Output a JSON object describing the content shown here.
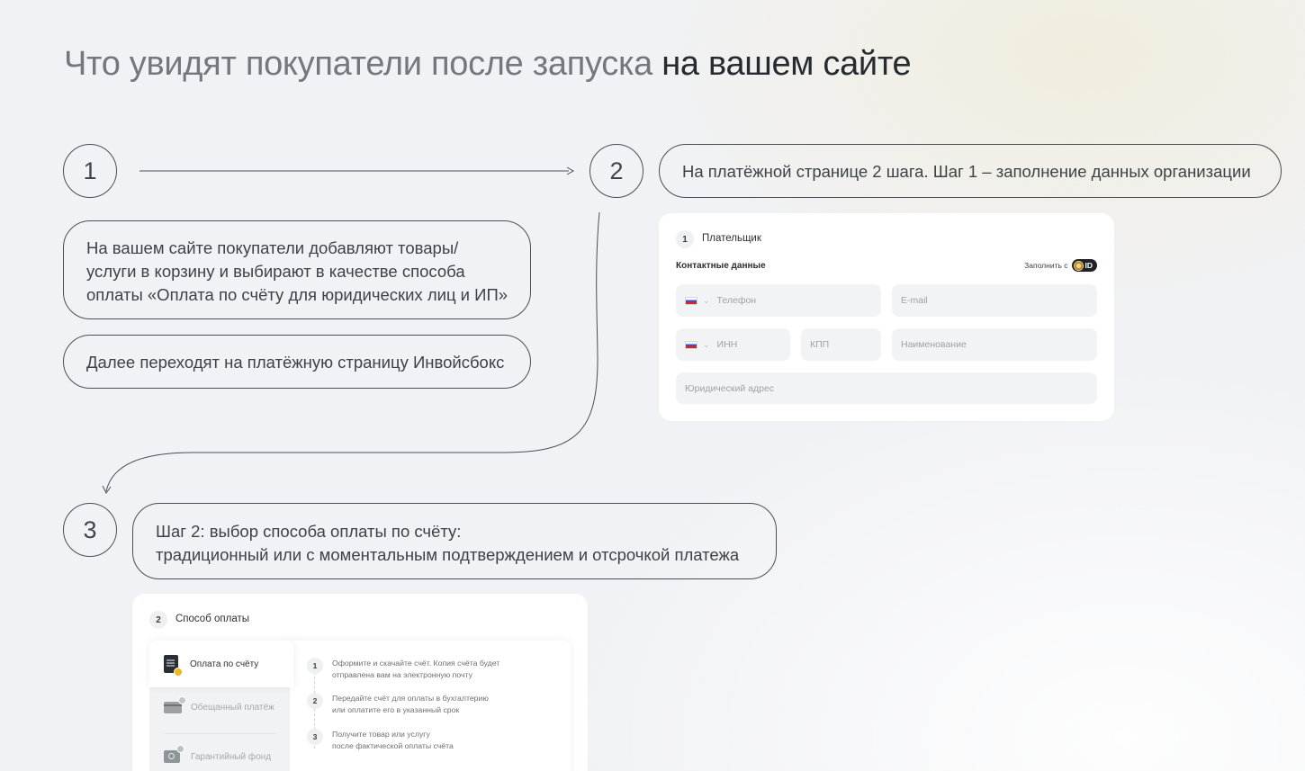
{
  "title": {
    "light": "Что увидят покупатели после запуска",
    "dark": "на вашем сайте"
  },
  "steps": [
    {
      "number": "1"
    },
    {
      "number": "2"
    },
    {
      "number": "3"
    }
  ],
  "step1": {
    "bubble_a_lines": [
      "На вашем сайте покупатели добавляют товары/",
      "услуги в корзину и выбирают в качестве способа",
      "оплаты «Оплата по счёту для юридических лиц и ИП»"
    ],
    "bubble_b": "Далее переходят на платёжную страницу Инвойсбокс"
  },
  "step2": {
    "caption": "На платёжной странице 2 шага. Шаг 1 – заполнение данных организации"
  },
  "step3": {
    "caption_lines": [
      "Шаг 2: выбор способа оплаты по счёту:",
      "традиционный или с моментальным подтверждением и отсрочкой платежа"
    ]
  },
  "payer_card": {
    "badge": "1",
    "title": "Плательщик",
    "section": "Контактные данные",
    "fill_with": "Заполнить с",
    "id_badge": "ID",
    "placeholders": {
      "phone": "Телефон",
      "email": "E-mail",
      "inn": "ИНН",
      "kpp": "КПП",
      "name": "Наименование",
      "address": "Юридический адрес"
    },
    "flag_country": "RU",
    "chevron_icon": "chevron-down-icon"
  },
  "payment_card": {
    "badge": "2",
    "title": "Способ оплаты",
    "methods": [
      {
        "label": "Оплата по счёту",
        "icon": "invoice-document-icon",
        "active": true
      },
      {
        "label": "Обещанный платёж",
        "icon": "card-promise-icon",
        "active": false
      },
      {
        "label": "Гарантийный фонд",
        "icon": "safe-fund-icon",
        "active": false
      }
    ],
    "steps": [
      {
        "num": "1",
        "lines": [
          "Оформите и скачайте счёт. Копия счёта будет",
          "отправлена вам на электронную почту"
        ]
      },
      {
        "num": "2",
        "lines": [
          "Передайте счёт для оплаты в бухгалтерию",
          "или оплатите его в указанный срок"
        ]
      },
      {
        "num": "3",
        "lines": [
          "Получите товар или услугу",
          "после фактической оплаты счёта"
        ]
      }
    ]
  },
  "colors": {
    "outline": "#4a4f55",
    "title_light": "#74787d",
    "title_dark": "#262b31",
    "field_bg": "#f2f3f5",
    "coin": "#f3b81f"
  }
}
